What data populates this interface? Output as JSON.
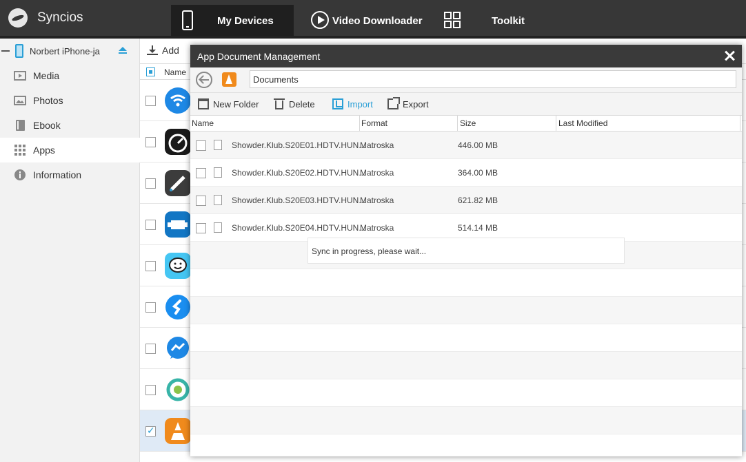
{
  "app": {
    "name": "Syncios"
  },
  "nav": {
    "devices": "My Devices",
    "video": "Video Downloader",
    "toolkit": "Toolkit"
  },
  "sidebar": {
    "device_name": "Norbert iPhone-ja",
    "items": [
      {
        "label": "Media",
        "icon": "media-icon"
      },
      {
        "label": "Photos",
        "icon": "photos-icon"
      },
      {
        "label": "Ebook",
        "icon": "ebook-icon"
      },
      {
        "label": "Apps",
        "icon": "apps-icon"
      },
      {
        "label": "Information",
        "icon": "info-icon"
      }
    ],
    "active": "Apps"
  },
  "applist": {
    "add_label": "Add",
    "name_header": "Name",
    "apps": [
      {
        "icon": "wifi-app-icon",
        "color": "#1e88e5"
      },
      {
        "icon": "speedtest-app-icon",
        "color": "#1a1a1a"
      },
      {
        "icon": "here-app-icon",
        "color": "#3c3c3c"
      },
      {
        "icon": "obd-car-app-icon",
        "color": "#1276c4"
      },
      {
        "icon": "waze-app-icon",
        "color": "#45c6f3"
      },
      {
        "icon": "shazam-app-icon",
        "color": "#1a8ef0"
      },
      {
        "icon": "messenger-app-icon",
        "color": "#1e88e5"
      },
      {
        "icon": "green-app-icon",
        "color": "#38b4a8"
      },
      {
        "icon": "vlc-app-icon",
        "color": "#f08a1c",
        "checked": true
      }
    ]
  },
  "modal": {
    "title": "App Document Management",
    "path": "Documents",
    "toolbar": {
      "new_folder": "New Folder",
      "delete": "Delete",
      "import": "Import",
      "export": "Export"
    },
    "columns": {
      "name": "Name",
      "format": "Format",
      "size": "Size",
      "modified": "Last Modified"
    },
    "files": [
      {
        "name": "Showder.Klub.S20E01.HDTV.HUN...",
        "format": "Matroska",
        "size": "446.00 MB",
        "modified": ""
      },
      {
        "name": "Showder.Klub.S20E02.HDTV.HUN...",
        "format": "Matroska",
        "size": "364.00 MB",
        "modified": ""
      },
      {
        "name": "Showder.Klub.S20E03.HDTV.HUN...",
        "format": "Matroska",
        "size": "621.82 MB",
        "modified": ""
      },
      {
        "name": "Showder.Klub.S20E04.HDTV.HUN...",
        "format": "Matroska",
        "size": "514.14 MB",
        "modified": ""
      }
    ],
    "status": "Sync in progress, please wait..."
  },
  "colors": {
    "accent": "#2a9fd6",
    "topbar": "#373737",
    "modal_title": "#3a3a3a"
  }
}
